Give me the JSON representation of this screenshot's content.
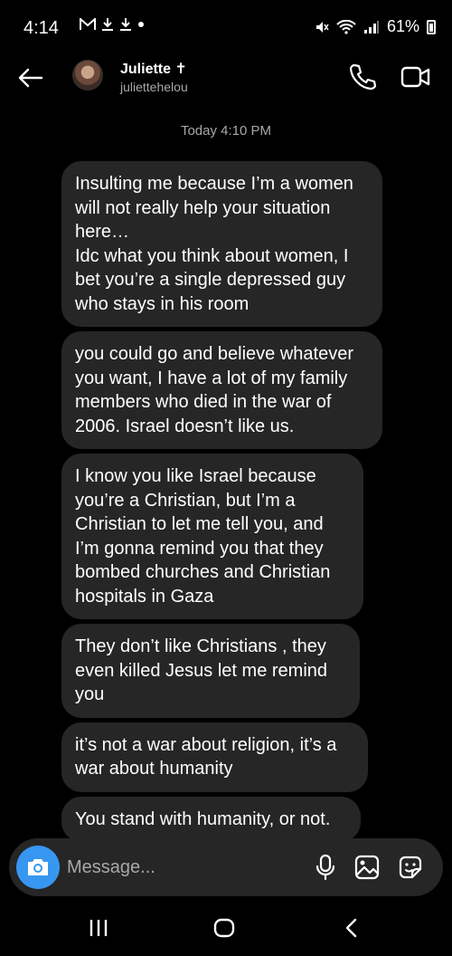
{
  "status_bar": {
    "time": "4:14",
    "left_icons": [
      "mail-icon",
      "download-icon",
      "download-icon",
      "dot-icon"
    ],
    "battery": "61%"
  },
  "header": {
    "name": "Juliette",
    "name_symbol": "✝",
    "handle": "juliettehelou"
  },
  "timestamp": "Today 4:10 PM",
  "messages": [
    {
      "text": "Insulting me because I’m a women will not really help your situation here…\nIdc what you think about women, I bet you’re a single depressed guy who stays in his room"
    },
    {
      "text": "you could go and believe whatever you want, I have a lot of my family members who died in the war of 2006. Israel doesn’t like us."
    },
    {
      "text": "I know you like Israel because you’re a Christian, but I’m a Christian to let me tell you, and I’m gonna remind you that they bombed churches and Christian hospitals in Gaza"
    },
    {
      "text": "They don’t like Christians , they even killed Jesus let me remind you"
    },
    {
      "text": "it’s not a war about religion, it’s a war about humanity"
    },
    {
      "text": "You stand with humanity, or not."
    }
  ],
  "composer": {
    "placeholder": "Message..."
  },
  "colors": {
    "background": "#000000",
    "bubble": "#262626",
    "accent": "#3797f0",
    "secondary_text": "#a8a8a8"
  }
}
